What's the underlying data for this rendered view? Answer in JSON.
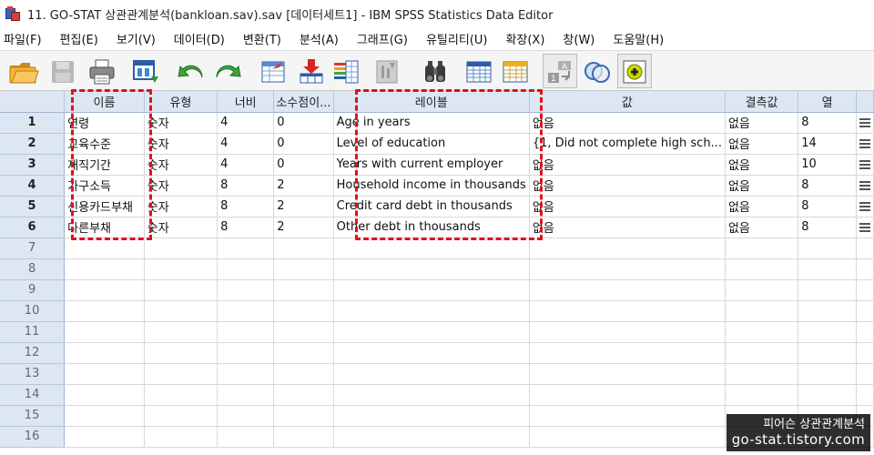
{
  "window": {
    "title": "11. GO-STAT 상관관계분석(bankloan.sav).sav [데이터세트1] - IBM SPSS Statistics Data Editor"
  },
  "menu": [
    "파일(F)",
    "편집(E)",
    "보기(V)",
    "데이터(D)",
    "변환(T)",
    "분석(A)",
    "그래프(G)",
    "유틸리티(U)",
    "확장(X)",
    "창(W)",
    "도움말(H)"
  ],
  "toolbar": {
    "icons": [
      "open-folder-icon",
      "save-icon",
      "print-icon",
      "dialog-recall-icon",
      "undo-icon",
      "redo-icon",
      "goto-case-icon",
      "goto-variable-icon",
      "variables-icon",
      "run-descriptive-icon",
      "find-icon",
      "insert-cases-icon",
      "insert-variable-icon",
      "split-file-icon",
      "weight-cases-icon",
      "select-cases-icon",
      "value-labels-icon",
      "use-sets-icon",
      "show-all-variables-icon"
    ]
  },
  "grid": {
    "headers": [
      "이름",
      "유형",
      "너비",
      "소수점이...",
      "레이블",
      "값",
      "결측값",
      "열"
    ],
    "rows": [
      {
        "num": "1",
        "name": "연령",
        "type": "숫자",
        "width": "4",
        "decimals": "0",
        "label": "Age in years",
        "values": "없음",
        "missing": "없음",
        "columns": "8"
      },
      {
        "num": "2",
        "name": "교육수준",
        "type": "숫자",
        "width": "4",
        "decimals": "0",
        "label": "Level of education",
        "values": "{1, Did not complete high sch...",
        "missing": "없음",
        "columns": "14"
      },
      {
        "num": "3",
        "name": "재직기간",
        "type": "숫자",
        "width": "4",
        "decimals": "0",
        "label": "Years with current employer",
        "values": "없음",
        "missing": "없음",
        "columns": "10"
      },
      {
        "num": "4",
        "name": "가구소득",
        "type": "숫자",
        "width": "8",
        "decimals": "2",
        "label": "Household income in thousands",
        "values": "없음",
        "missing": "없음",
        "columns": "8"
      },
      {
        "num": "5",
        "name": "신용카드부채",
        "type": "숫자",
        "width": "8",
        "decimals": "2",
        "label": "Credit card debt in thousands",
        "values": "없음",
        "missing": "없음",
        "columns": "8"
      },
      {
        "num": "6",
        "name": "다른부채",
        "type": "숫자",
        "width": "8",
        "decimals": "2",
        "label": "Other debt in thousands",
        "values": "없음",
        "missing": "없음",
        "columns": "8"
      }
    ],
    "empty_rows": [
      "7",
      "8",
      "9",
      "10",
      "11",
      "12",
      "13",
      "14",
      "15",
      "16"
    ]
  },
  "watermark": {
    "line1": "피어슨 상관관계분석",
    "line2": "go-stat.tistory.com"
  },
  "colors": {
    "header_bg": "#dde7f3",
    "highlight": "#e0101a"
  }
}
